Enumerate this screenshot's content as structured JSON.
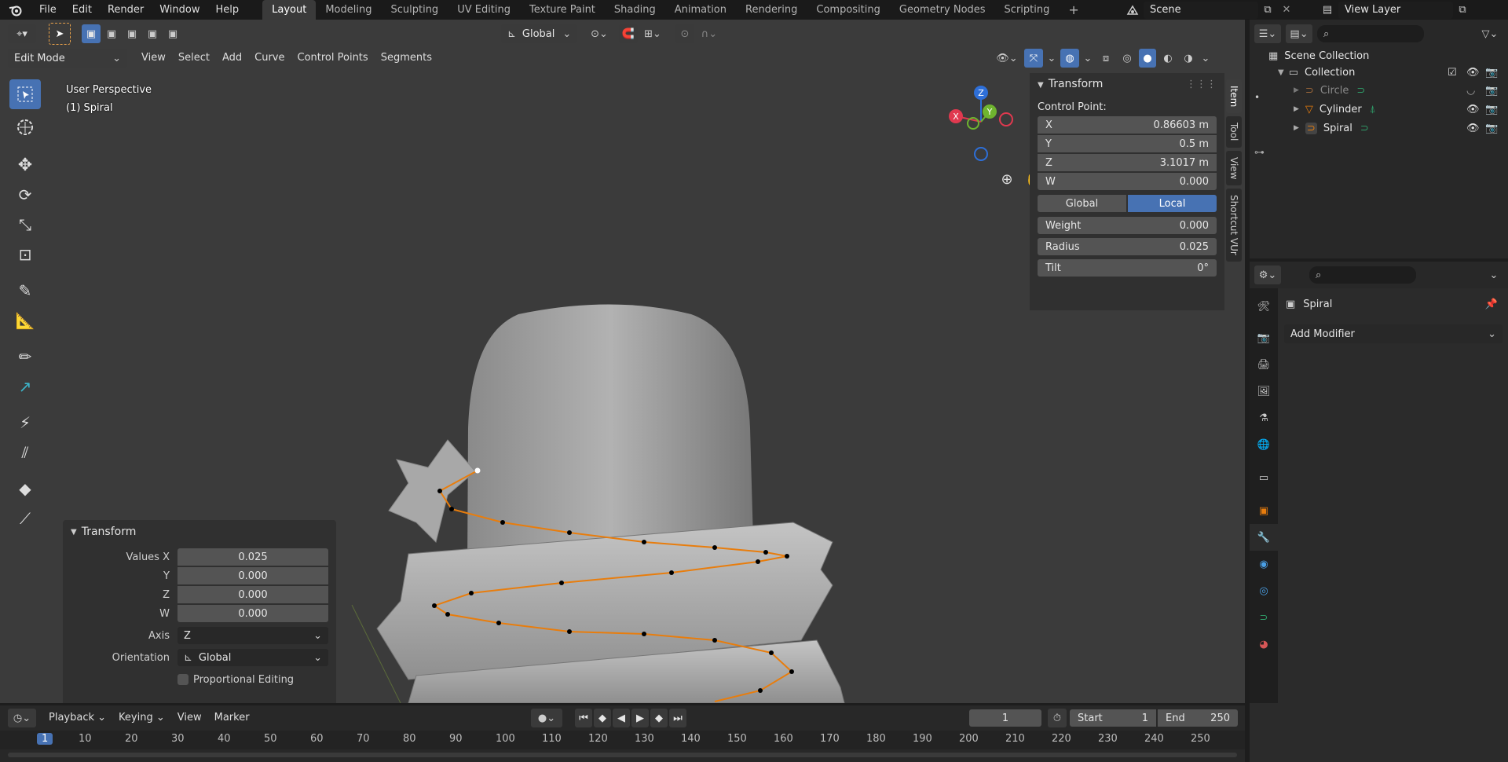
{
  "topbar": {
    "menus": [
      "File",
      "Edit",
      "Render",
      "Window",
      "Help"
    ],
    "workspaces": [
      "Layout",
      "Modeling",
      "Sculpting",
      "UV Editing",
      "Texture Paint",
      "Shading",
      "Animation",
      "Rendering",
      "Compositing",
      "Geometry Nodes",
      "Scripting"
    ],
    "active_workspace": "Layout",
    "add_tab": "+",
    "scene_label": "Scene",
    "view_layer_label": "View Layer"
  },
  "viewport": {
    "mode": "Edit Mode",
    "header_menus": [
      "View",
      "Select",
      "Add",
      "Curve",
      "Control Points",
      "Segments"
    ],
    "orientation": "Global",
    "overlay_title": "User Perspective",
    "overlay_object": "(1) Spiral",
    "gizmo": {
      "x": "X",
      "y": "Y",
      "z": "Z"
    }
  },
  "n_panel": {
    "title": "Transform",
    "section": "Control Point:",
    "rows": [
      {
        "label": "X",
        "value": "0.86603 m"
      },
      {
        "label": "Y",
        "value": "0.5 m"
      },
      {
        "label": "Z",
        "value": "3.1017 m"
      },
      {
        "label": "W",
        "value": "0.000"
      }
    ],
    "toggle": {
      "global": "Global",
      "local": "Local",
      "active": "Local"
    },
    "props": [
      {
        "label": "Weight",
        "value": "0.000"
      },
      {
        "label": "Radius",
        "value": "0.025"
      },
      {
        "label": "Tilt",
        "value": "0°"
      }
    ],
    "tabs": [
      "Item",
      "Tool",
      "View",
      "Shortcut VUr"
    ]
  },
  "last_op": {
    "title": "Transform",
    "values_label": "Values X",
    "rows": [
      {
        "label": "Values X",
        "value": "0.025"
      },
      {
        "label": "Y",
        "value": "0.000"
      },
      {
        "label": "Z",
        "value": "0.000"
      },
      {
        "label": "W",
        "value": "0.000"
      }
    ],
    "axis_label": "Axis",
    "axis_value": "Z",
    "orientation_label": "Orientation",
    "orientation_value": "Global",
    "proportional": "Proportional Editing"
  },
  "outliner": {
    "root": "Scene Collection",
    "collection": "Collection",
    "items": [
      {
        "name": "Circle",
        "dim": true
      },
      {
        "name": "Cylinder",
        "dim": false
      },
      {
        "name": "Spiral",
        "dim": false
      }
    ]
  },
  "properties": {
    "object_name": "Spiral",
    "add_modifier": "Add Modifier"
  },
  "timeline": {
    "menus": [
      "Playback",
      "Keying",
      "View",
      "Marker"
    ],
    "current_frame": "1",
    "start_label": "Start",
    "start_value": "1",
    "end_label": "End",
    "end_value": "250",
    "ruler": [
      "1",
      "10",
      "20",
      "30",
      "40",
      "50",
      "60",
      "70",
      "80",
      "90",
      "100",
      "110",
      "120",
      "130",
      "140",
      "150",
      "160",
      "170",
      "180",
      "190",
      "200",
      "210",
      "220",
      "230",
      "240",
      "250"
    ]
  },
  "colors": {
    "accent": "#4772b3",
    "curve": "#e87d0d",
    "bg_viewport": "#3b3b3b"
  }
}
